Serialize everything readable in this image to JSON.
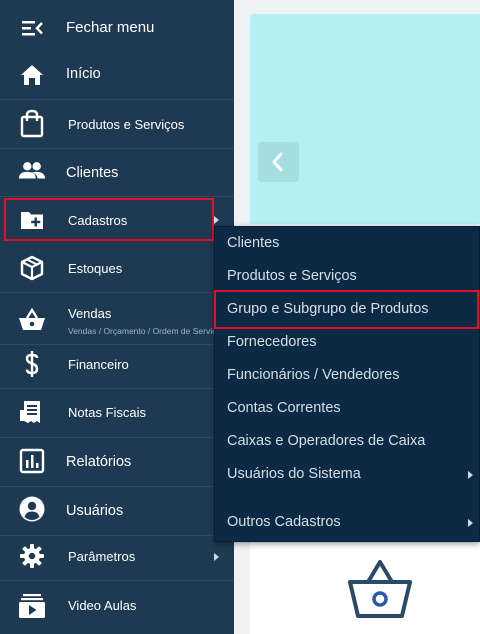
{
  "sidebar": {
    "close_menu": "Fechar menu",
    "items": [
      {
        "label": "Início",
        "icon": "home-icon"
      },
      {
        "label": "Produtos e Serviços",
        "icon": "shopping-bag-icon"
      },
      {
        "label": "Clientes",
        "icon": "people-icon"
      },
      {
        "label": "Cadastros",
        "icon": "folder-plus-icon"
      },
      {
        "label": "Estoques",
        "icon": "box-icon"
      },
      {
        "label": "Vendas",
        "icon": "basket-icon",
        "sublabel": "Vendas / Orçamento / Ordem de Serviço"
      },
      {
        "label": "Financeiro",
        "icon": "dollar-icon"
      },
      {
        "label": "Notas Fiscais",
        "icon": "receipt-icon"
      },
      {
        "label": "Relatórios",
        "icon": "bar-chart-icon"
      },
      {
        "label": "Usuários",
        "icon": "user-circle-icon"
      },
      {
        "label": "Parâmetros",
        "icon": "gear-icon"
      },
      {
        "label": "Video Aulas",
        "icon": "video-library-icon"
      }
    ]
  },
  "submenu": {
    "items": [
      "Clientes",
      "Produtos e Serviços",
      "Grupo e Subgrupo de Produtos",
      "Fornecedores",
      "Funcionários / Vendedores",
      "Contas Correntes",
      "Caixas e Operadores de Caixa",
      "Usuários do Sistema",
      "Outros Cadastros"
    ]
  },
  "colors": {
    "sidebar_bg": "#1e3a52",
    "submenu_bg": "#0d2a45",
    "highlight_border": "#e0102a",
    "banner_bg": "#b4f0ef",
    "basket_icon": "#2a4a6a"
  }
}
